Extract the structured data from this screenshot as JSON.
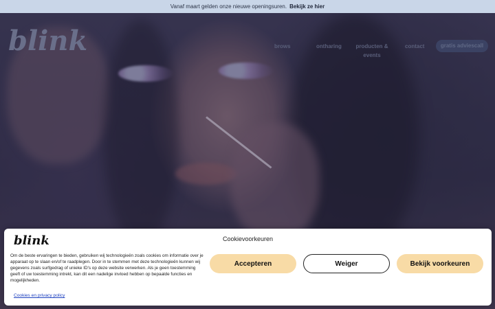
{
  "announcement": {
    "text": "Vanaf maart gelden onze nieuwe openingsuren.",
    "link": "Bekijk ze hier"
  },
  "brand": {
    "logo_text": "blink"
  },
  "nav": {
    "items": [
      {
        "label": "brows"
      },
      {
        "label": "ontharing"
      },
      {
        "label": "producten & events"
      },
      {
        "label": "contact"
      }
    ],
    "cta": "gratis adviescall"
  },
  "cookie_banner": {
    "logo_text": "blink",
    "title": "Cookievoorkeuren",
    "body": "Om de beste ervaringen te bieden, gebruiken wij technologieën zoals cookies om informatie over je apparaat op te slaan en/of te raadplegen. Door in te stemmen met deze technologieën kunnen wij gegevens zoals surfgedrag of unieke ID's op deze website verwerken. Als je geen toestemming geeft of uw toestemming intrekt, kan dit een nadelige invloed hebben op bepaalde functies en mogelijkheden.",
    "policy_link": "Cookies en privacy policy",
    "buttons": {
      "accept": "Accepteren",
      "deny": "Weiger",
      "preferences": "Bekijk voorkeuren"
    }
  },
  "colors": {
    "accent": "#f8dba6",
    "announcement_bg": "#c9d6e8",
    "cta_bg": "#3b4263"
  }
}
